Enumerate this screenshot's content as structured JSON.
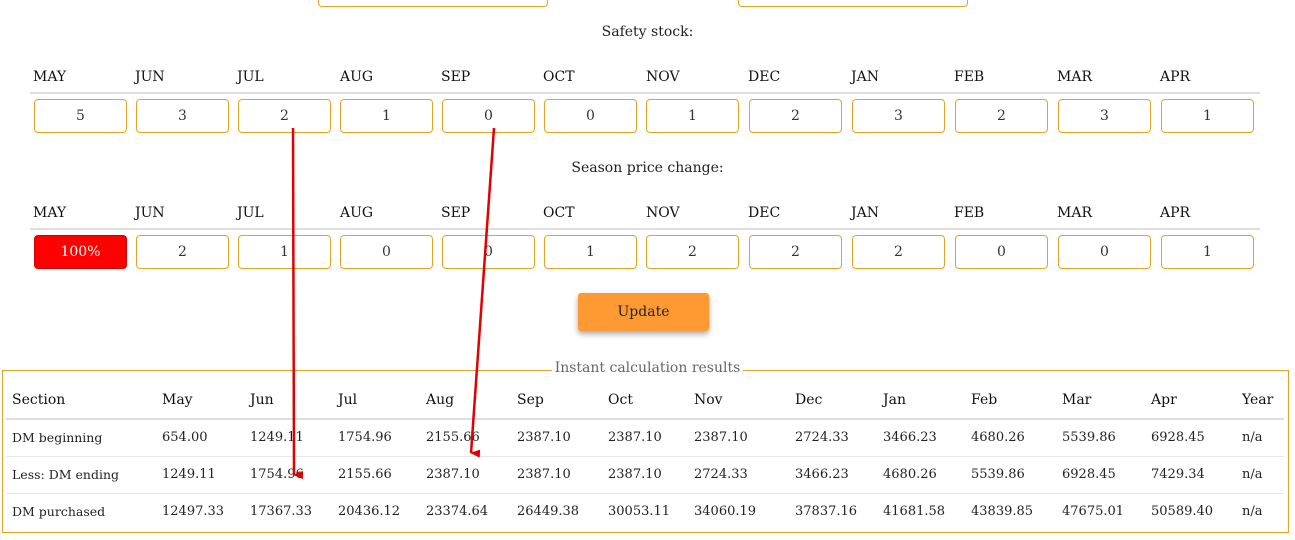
{
  "safety": {
    "title": "Safety stock:",
    "months": [
      "MAY",
      "JUN",
      "JUL",
      "AUG",
      "SEP",
      "OCT",
      "NOV",
      "DEC",
      "JAN",
      "FEB",
      "MAR",
      "APR"
    ],
    "values": [
      "5",
      "3",
      "2",
      "1",
      "0",
      "0",
      "1",
      "2",
      "3",
      "2",
      "3",
      "1"
    ]
  },
  "season": {
    "title": "Season price change:",
    "months": [
      "MAY",
      "JUN",
      "JUL",
      "AUG",
      "SEP",
      "OCT",
      "NOV",
      "DEC",
      "JAN",
      "FEB",
      "MAR",
      "APR"
    ],
    "values": [
      "100%",
      "2",
      "1",
      "0",
      "0",
      "1",
      "2",
      "2",
      "2",
      "0",
      "0",
      "1"
    ],
    "highlight_color": "#ff0000"
  },
  "update_label": "Update",
  "results": {
    "legend": "Instant calculation results",
    "headers": [
      "Section",
      "May",
      "Jun",
      "Jul",
      "Aug",
      "Sep",
      "Oct",
      "Nov",
      "Dec",
      "Jan",
      "Feb",
      "Mar",
      "Apr",
      "Year"
    ],
    "rows": [
      [
        "DM beginning",
        "654.00",
        "1249.11",
        "1754.96",
        "2155.66",
        "2387.10",
        "2387.10",
        "2387.10",
        "2724.33",
        "3466.23",
        "4680.26",
        "5539.86",
        "6928.45",
        "n/a"
      ],
      [
        "Less: DM ending",
        "1249.11",
        "1754.96",
        "2155.66",
        "2387.10",
        "2387.10",
        "2387.10",
        "2724.33",
        "3466.23",
        "4680.26",
        "5539.86",
        "6928.45",
        "7429.34",
        "n/a"
      ],
      [
        "DM purchased",
        "12497.33",
        "17367.33",
        "20436.12",
        "23374.64",
        "26449.38",
        "30053.11",
        "34060.19",
        "37837.16",
        "41681.58",
        "43839.85",
        "47675.01",
        "50589.40",
        "n/a"
      ]
    ]
  },
  "colors": {
    "accent": "#ff9a33",
    "border": "#e0a526",
    "annotation_arrow": "#e00000"
  }
}
